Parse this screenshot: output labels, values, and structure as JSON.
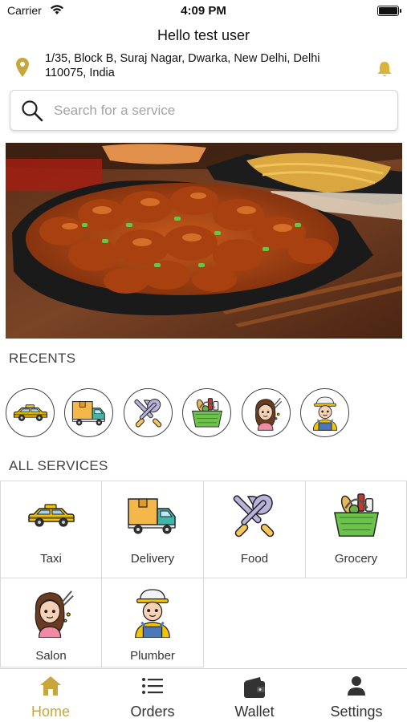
{
  "status_bar": {
    "carrier": "Carrier",
    "time": "4:09 PM"
  },
  "header": {
    "greeting": "Hello test user",
    "address_line1": "1/35, Block B, Suraj Nagar, Dwarka, New Delhi, Delhi",
    "address_line2": "110075, India",
    "icons": [
      "location-pin-icon",
      "bell-icon"
    ]
  },
  "search": {
    "placeholder": "Search for a service",
    "value": ""
  },
  "banner": {
    "subject": "food-banner"
  },
  "recents": {
    "title": "RECENTS",
    "items": [
      "taxi-icon",
      "delivery-truck-icon",
      "food-utensils-icon",
      "grocery-basket-icon",
      "salon-icon",
      "plumber-icon"
    ]
  },
  "services": {
    "title": "ALL SERVICES",
    "items": [
      {
        "label": "Taxi",
        "icon": "taxi-icon"
      },
      {
        "label": "Delivery",
        "icon": "delivery-truck-icon"
      },
      {
        "label": "Food",
        "icon": "food-utensils-icon"
      },
      {
        "label": "Grocery",
        "icon": "grocery-basket-icon"
      },
      {
        "label": "Salon",
        "icon": "salon-icon"
      },
      {
        "label": "Plumber",
        "icon": "plumber-icon"
      }
    ]
  },
  "tabbar": {
    "active": "Home",
    "tabs": [
      {
        "label": "Home",
        "icon": "home-icon"
      },
      {
        "label": "Orders",
        "icon": "list-icon"
      },
      {
        "label": "Wallet",
        "icon": "wallet-icon"
      },
      {
        "label": "Settings",
        "icon": "person-icon"
      }
    ]
  },
  "colors": {
    "accent": "#c8a63a",
    "taxi_yellow": "#f5c400",
    "text": "#222222"
  }
}
